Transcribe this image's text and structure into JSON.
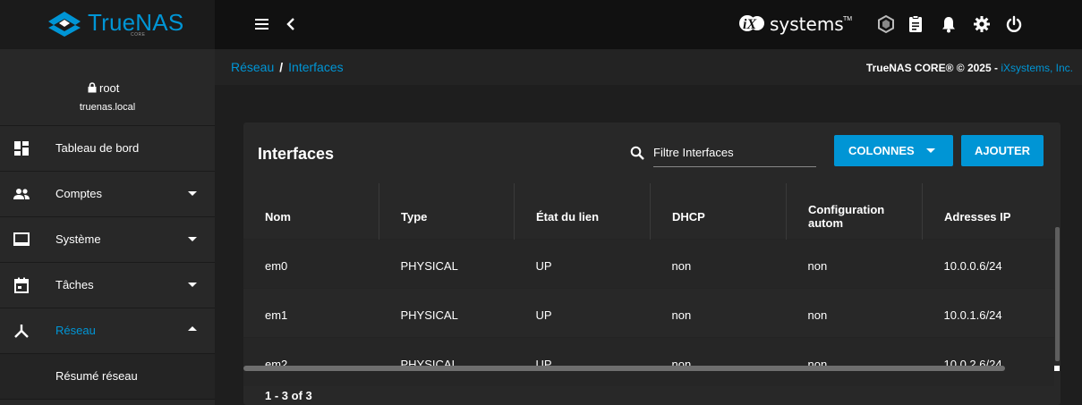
{
  "brand": {
    "name": "TrueNAS",
    "edition": "CORE"
  },
  "topbar": {
    "menu_icon": "hamburger-icon",
    "back_icon": "chevron-left-icon",
    "vendor": "systems",
    "vendor_mark": "iX",
    "vendor_tm": "TM",
    "icons": [
      "truecommand-icon",
      "clipboard-icon",
      "bell-icon",
      "gear-icon",
      "power-icon"
    ]
  },
  "user": {
    "name": "root",
    "host": "truenas.local"
  },
  "sidebar": {
    "items": [
      {
        "label": "Tableau de bord",
        "icon": "dashboard-icon"
      },
      {
        "label": "Comptes",
        "icon": "accounts-icon"
      },
      {
        "label": "Système",
        "icon": "monitor-icon"
      },
      {
        "label": "Tâches",
        "icon": "calendar-icon"
      },
      {
        "label": "Réseau",
        "icon": "network-icon"
      }
    ],
    "subitems": [
      {
        "label": "Résumé réseau"
      }
    ]
  },
  "breadcrumb": {
    "parent": "Réseau",
    "separator": "/",
    "current": "Interfaces"
  },
  "copyright": {
    "text": "TrueNAS CORE® © 2025 - ",
    "link": "iXsystems, Inc."
  },
  "card": {
    "title": "Interfaces",
    "search_placeholder": "Filtre Interfaces",
    "columns_button": "COLONNES",
    "add_button": "AJOUTER",
    "headers": [
      "Nom",
      "Type",
      "État du lien",
      "DHCP",
      "Configuration autom",
      "Adresses IP"
    ],
    "rows": [
      [
        "em0",
        "PHYSICAL",
        "UP",
        "non",
        "non",
        "10.0.0.6/24"
      ],
      [
        "em1",
        "PHYSICAL",
        "UP",
        "non",
        "non",
        "10.0.1.6/24"
      ],
      [
        "em2",
        "PHYSICAL",
        "UP",
        "non",
        "non",
        "10.0.2.6/24"
      ]
    ],
    "paging": "1 - 3 of 3"
  },
  "colors": {
    "accent": "#0095d5",
    "background": "#1e1e1e",
    "card": "#282828",
    "sidebar": "#282828"
  }
}
